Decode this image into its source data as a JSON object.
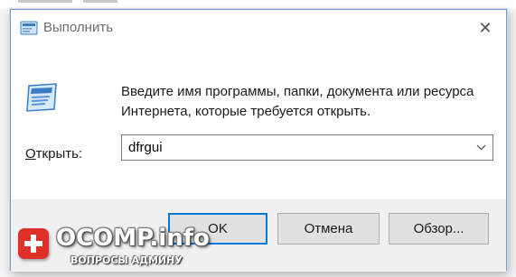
{
  "dialog": {
    "title": "Выполнить",
    "close_glyph": "✕",
    "description": "Введите имя программы, папки, документа или ресурса Интернета, которые требуется открыть.",
    "open_label_accel": "О",
    "open_label_rest": "ткрыть:",
    "open_value": "dfrgui",
    "icons": {
      "title": "run-icon",
      "app": "run-icon",
      "combo_arrow": "chevron-down-icon",
      "close": "close-icon"
    }
  },
  "buttons": {
    "ok": "OK",
    "cancel": "Отмена",
    "browse": "Обзор..."
  },
  "watermark": {
    "main": "OCOMP.info",
    "sub": "ВОПРОСЫ АДМИНУ",
    "badge_color": "#e0302a"
  },
  "colors": {
    "accent": "#0078d7",
    "dialog_border": "#7a9fc7",
    "button_face": "#e1e1e1",
    "button_row_bg": "#f0f0f0"
  }
}
